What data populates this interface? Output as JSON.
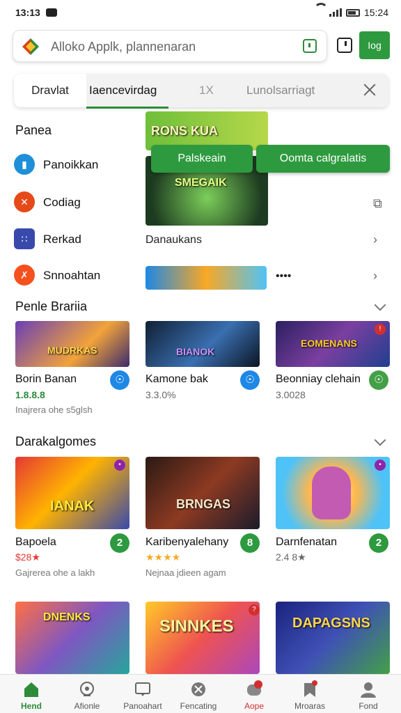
{
  "status_bar": {
    "time": "13:13",
    "time_right": "15:24"
  },
  "search": {
    "placeholder": "Alloko Applk, plannenaran",
    "go_label": "Iog"
  },
  "tabs": [
    {
      "label": "Dravlat"
    },
    {
      "label": "Iaencevirdag"
    },
    {
      "label": "1X"
    },
    {
      "label": "Lunolsarriagt"
    }
  ],
  "categories_section": {
    "title": "Panea",
    "items": [
      {
        "label": "Panoikkan",
        "icon": "book-icon",
        "color": "#1f8fd8"
      },
      {
        "label": "Codiag",
        "icon": "code-icon",
        "color": "#e64a19"
      },
      {
        "label": "Rerkad",
        "icon": "dice-icon",
        "color": "#3949ab"
      },
      {
        "label": "Snnoahtan",
        "icon": "cross-icon",
        "color": "#f4511e"
      }
    ]
  },
  "featured": {
    "banner_text": "RONS KUA",
    "art_title": "SMEGAIK",
    "secondary_label": "Danaukans",
    "more_label": "••••",
    "pill_left": "Palskeain",
    "pill_right": "Oomta calgralatis"
  },
  "popular_section": {
    "title": "Penle Brariia",
    "cards": [
      {
        "art_text": "MUDRKAS",
        "name": "Borin Banan",
        "sub": "1.8.8.8",
        "meta": "Inajrera ohe s5glsh",
        "badge_color": "#1e88e5"
      },
      {
        "art_text": "BIANOK",
        "name": "Kamone bak",
        "sub": "3.3.0%",
        "meta": "",
        "badge_color": "#1e88e5"
      },
      {
        "art_text": "EOMENANS",
        "name": "Beonniay clehain",
        "sub": "3.0028",
        "meta": "",
        "badge_color": "#43a047"
      }
    ]
  },
  "dark_section": {
    "title": "Darakalgomes",
    "cards": [
      {
        "art_text": "IANAK",
        "name": "Bapoela",
        "sub": "$28★",
        "meta": "Gajrerea ohe a lakh",
        "badge": "2",
        "stars_color": "#e53935"
      },
      {
        "art_text": "BRNGAS",
        "name": "Karibenyalehany",
        "sub": "★★★★",
        "meta": "Nejnaa jdieen agam",
        "badge": "8",
        "stars_color": "#f9a825"
      },
      {
        "art_text": "",
        "name": "Darnfenatan",
        "sub": "2.4 8★",
        "meta": "",
        "badge": "2",
        "stars_color": "#777777"
      }
    ]
  },
  "more_row": [
    {
      "art_text": "DNENKS"
    },
    {
      "art_text": "SINNKES"
    },
    {
      "art_text": "DAPAGSNS"
    }
  ],
  "bottom_nav": [
    {
      "label": "Hend",
      "icon": "home-icon"
    },
    {
      "label": "Afionle",
      "icon": "bell-icon"
    },
    {
      "label": "Panoahart",
      "icon": "chat-icon"
    },
    {
      "label": "Fencating",
      "icon": "compass-icon"
    },
    {
      "label": "Aope",
      "icon": "apps-icon"
    },
    {
      "label": "Mroaras",
      "icon": "bookmark-icon"
    },
    {
      "label": "Fond",
      "icon": "profile-icon"
    }
  ],
  "colors": {
    "accent": "#2e9a3f",
    "red_badge": "#d32f2f"
  }
}
